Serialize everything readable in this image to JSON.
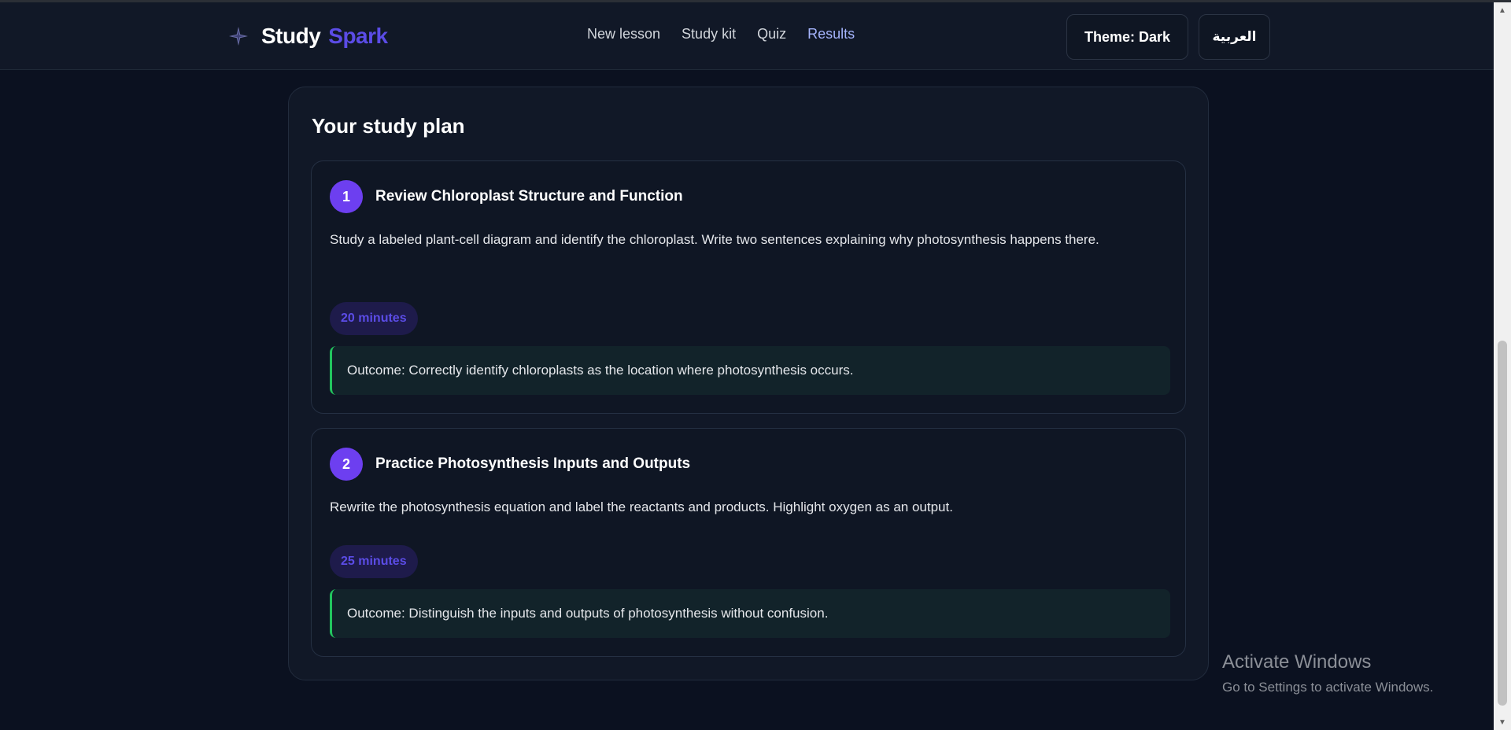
{
  "app": {
    "brand_part1": "Study",
    "brand_part2": "Spark",
    "brand_icon": "sparkle-icon",
    "accent_color": "#5b4ce6"
  },
  "nav": {
    "links": [
      "New lesson",
      "Study kit",
      "Quiz",
      "Results"
    ],
    "active": "Results"
  },
  "header_buttons": {
    "theme_label": "Theme: Dark",
    "language_label": "العربية"
  },
  "plan": {
    "title": "Your study plan",
    "steps": [
      {
        "number": "1",
        "title": "Review Chloroplast Structure and Function",
        "description": "Study a labeled plant-cell diagram and identify the chloroplast. Write two sentences explaining why photosynthesis happens there.",
        "duration": "20 minutes",
        "outcome": "Outcome: Correctly identify chloroplasts as the location where photosynthesis occurs."
      },
      {
        "number": "2",
        "title": "Practice Photosynthesis Inputs and Outputs",
        "description": "Rewrite the photosynthesis equation and label the reactants and products. Highlight oxygen as an output.",
        "duration": "25 minutes",
        "outcome": "Outcome: Distinguish the inputs and outputs of photosynthesis without confusion."
      }
    ]
  },
  "watermark": {
    "title": "Activate Windows",
    "subtitle": "Go to Settings to activate Windows."
  }
}
